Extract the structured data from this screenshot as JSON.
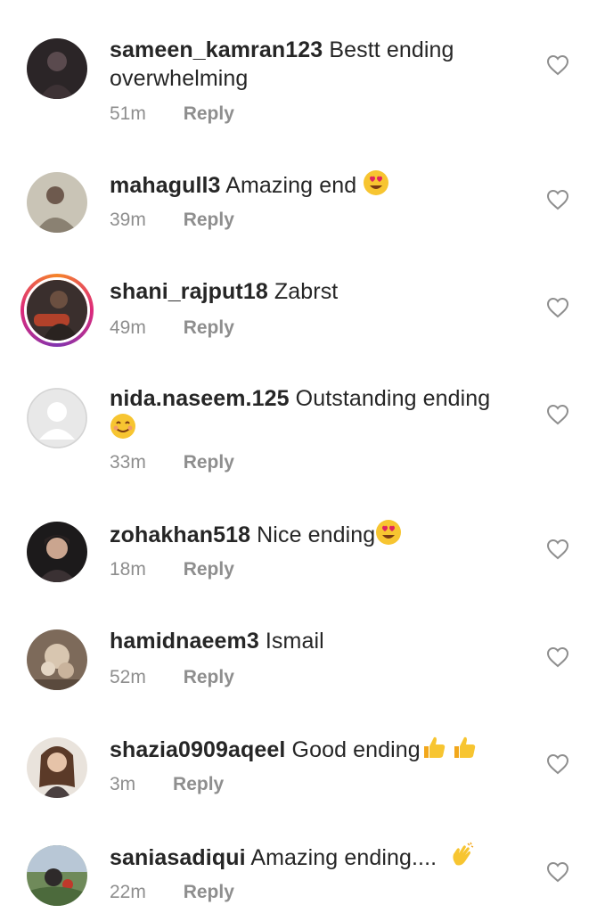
{
  "comments": [
    {
      "username": "sameen_kamran123",
      "text_line1": "Bestt ending",
      "text_line2": "overwhelming",
      "time": "51m",
      "reply": "Reply"
    },
    {
      "username": "mahagull3",
      "text": "Amazing end",
      "emoji": "heart-eyes",
      "time": "39m",
      "reply": "Reply"
    },
    {
      "username": "shani_rajput18",
      "text": "Zabrst",
      "time": "49m",
      "reply": "Reply"
    },
    {
      "username": "nida.naseem.125",
      "text": "Outstanding ending",
      "emoji": "smiling-face",
      "time": "33m",
      "reply": "Reply"
    },
    {
      "username": "zohakhan518",
      "text": "Nice ending",
      "emoji": "heart-eyes",
      "time": "18m",
      "reply": "Reply"
    },
    {
      "username": "hamidnaeem3",
      "text": "Ismail",
      "time": "52m",
      "reply": "Reply"
    },
    {
      "username": "shazia0909aqeel",
      "text": "Good ending",
      "emoji": "thumbs-up x2",
      "time": "3m",
      "reply": "Reply"
    },
    {
      "username": "saniasadiqui",
      "text": "Amazing ending....",
      "emoji": "waving-hand",
      "time": "22m",
      "reply": "Reply"
    }
  ],
  "icons": {
    "like": "heart-outline-icon"
  },
  "colors": {
    "text": "#262626",
    "muted": "#8e8e8e",
    "background": "#ffffff"
  }
}
